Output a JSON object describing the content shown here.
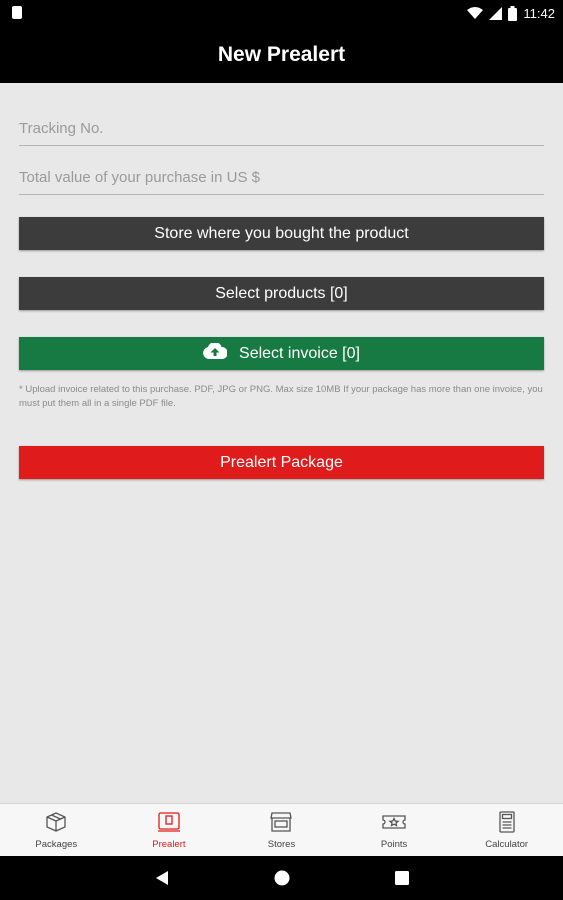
{
  "status_bar": {
    "time": "11:42",
    "icons": [
      "wifi-icon",
      "signal-icon",
      "battery-icon"
    ]
  },
  "app_bar": {
    "title": "New Prealert"
  },
  "form": {
    "tracking_placeholder": "Tracking No.",
    "value_placeholder": "Total value of your purchase in US $",
    "store_button": "Store where you bought the product",
    "products_button": "Select products [0]",
    "invoice_button": "Select invoice [0]",
    "invoice_note": "* Upload invoice related to this purchase. PDF, JPG or PNG. Max size 10MB If your package has more than one invoice, you must put them all in a single PDF file.",
    "submit_button": "Prealert Package"
  },
  "bottom_nav": {
    "items": [
      {
        "label": "Packages",
        "icon": "box-icon",
        "active": false
      },
      {
        "label": "Prealert",
        "icon": "tablet-icon",
        "active": true
      },
      {
        "label": "Stores",
        "icon": "store-icon",
        "active": false
      },
      {
        "label": "Points",
        "icon": "ticket-icon",
        "active": false
      },
      {
        "label": "Calculator",
        "icon": "calculator-icon",
        "active": false
      }
    ]
  },
  "colors": {
    "accent_red": "#e01b1b",
    "green": "#177a43",
    "dark_button": "#3c3c3c",
    "bar": "#000000"
  }
}
